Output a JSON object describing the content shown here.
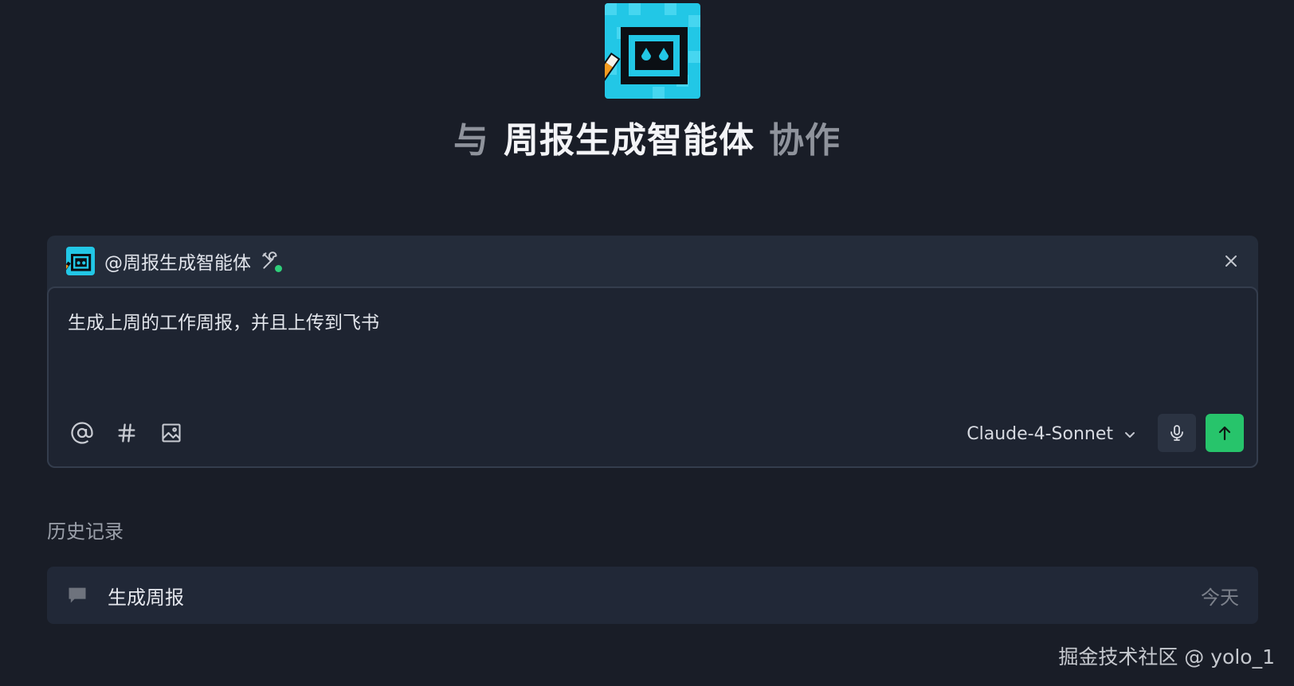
{
  "hero": {
    "prefix": "与",
    "agent_name": "周报生成智能体",
    "suffix": "协作",
    "logo_icon": "robot-screen-pencil-icon"
  },
  "composer": {
    "agent_tag": "@周报生成智能体",
    "agent_avatar_icon": "robot-screen-pencil-icon",
    "tools_icon": "tools-icon",
    "tools_status_color": "#2fcf7a",
    "close_icon": "close-icon",
    "prompt_text": "生成上周的工作周报，并且上传到飞书",
    "tool_icons": [
      "at-icon",
      "hash-icon",
      "image-icon"
    ],
    "model": "Claude-4-Sonnet",
    "mic_icon": "microphone-icon",
    "send_icon": "arrow-up-icon",
    "send_color": "#27c46b"
  },
  "history": {
    "heading": "历史记录",
    "items": [
      {
        "title": "生成周报",
        "date": "今天",
        "icon": "chat-bubble-icon"
      }
    ]
  },
  "watermark": "掘金技术社区 @ yolo_1"
}
